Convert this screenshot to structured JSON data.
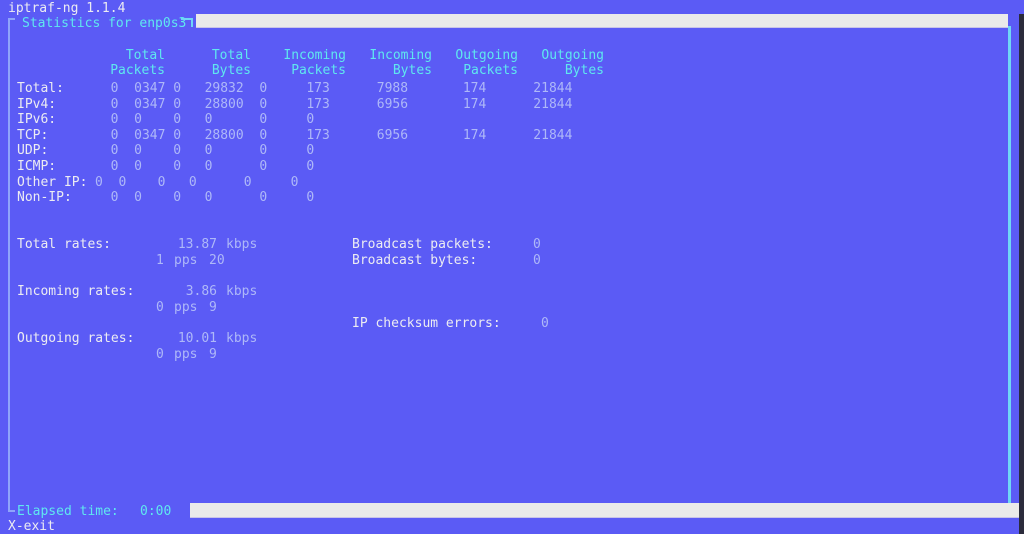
{
  "app": {
    "title": "iptraf-ng 1.1.4",
    "panel_label": "Statistics for enp0s3"
  },
  "colors": {
    "background": "#5b5bf5",
    "text": "#ececf2",
    "accent_cyan": "#5fe8ef",
    "value": "#aeb8f8",
    "border": "#8fa4fb",
    "bar": "#eaeaea"
  },
  "table": {
    "headers": [
      {
        "line1": "Total",
        "line2": "Packets"
      },
      {
        "line1": "Total",
        "line2": "Bytes"
      },
      {
        "line1": "Incoming",
        "line2": "Packets"
      },
      {
        "line1": "Incoming",
        "line2": "Bytes"
      },
      {
        "line1": "Outgoing",
        "line2": "Packets"
      },
      {
        "line1": "Outgoing",
        "line2": "Bytes"
      }
    ],
    "rows": [
      {
        "label": "Total:",
        "cells": "  0  0347 0   29832  0     173      7988       174      21844"
      },
      {
        "label": "IPv4:",
        "cells": "  0  0347 0   28800  0     173      6956       174      21844"
      },
      {
        "label": "IPv6:",
        "cells": "  0  0    0   0      0     0"
      },
      {
        "label": "TCP:",
        "cells": "  0  0347 0   28800  0     173      6956       174      21844"
      },
      {
        "label": "UDP:",
        "cells": "  0  0    0   0      0     0"
      },
      {
        "label": "ICMP:",
        "cells": "  0  0    0   0      0     0"
      },
      {
        "label": "Other IP:",
        "cells": "0  0    0   0      0     0"
      },
      {
        "label": "Non-IP:",
        "cells": "  0  0    0   0      0     0"
      }
    ]
  },
  "rates": {
    "total": {
      "label": "Total rates:",
      "value": "13.87",
      "unit": "kbps",
      "pps_value": "1",
      "pps_unit": "pps",
      "pps_extra": "20"
    },
    "incoming": {
      "label": "Incoming rates:",
      "value": "3.86",
      "unit": "kbps",
      "pps_value": "0",
      "pps_unit": "pps",
      "pps_extra": "9"
    },
    "outgoing": {
      "label": "Outgoing rates:",
      "value": "10.01",
      "unit": "kbps",
      "pps_value": "0",
      "pps_unit": "pps",
      "pps_extra": "9"
    }
  },
  "counters": {
    "broadcast_packets": {
      "label": "Broadcast packets:",
      "value": "0"
    },
    "broadcast_bytes": {
      "label": "Broadcast bytes:",
      "value": "0"
    },
    "ip_checksum_errors": {
      "label": "IP checksum errors:",
      "value": "0"
    }
  },
  "status": {
    "elapsed_label": "Elapsed time:",
    "elapsed_value": "0:00",
    "keys": "X-exit"
  }
}
